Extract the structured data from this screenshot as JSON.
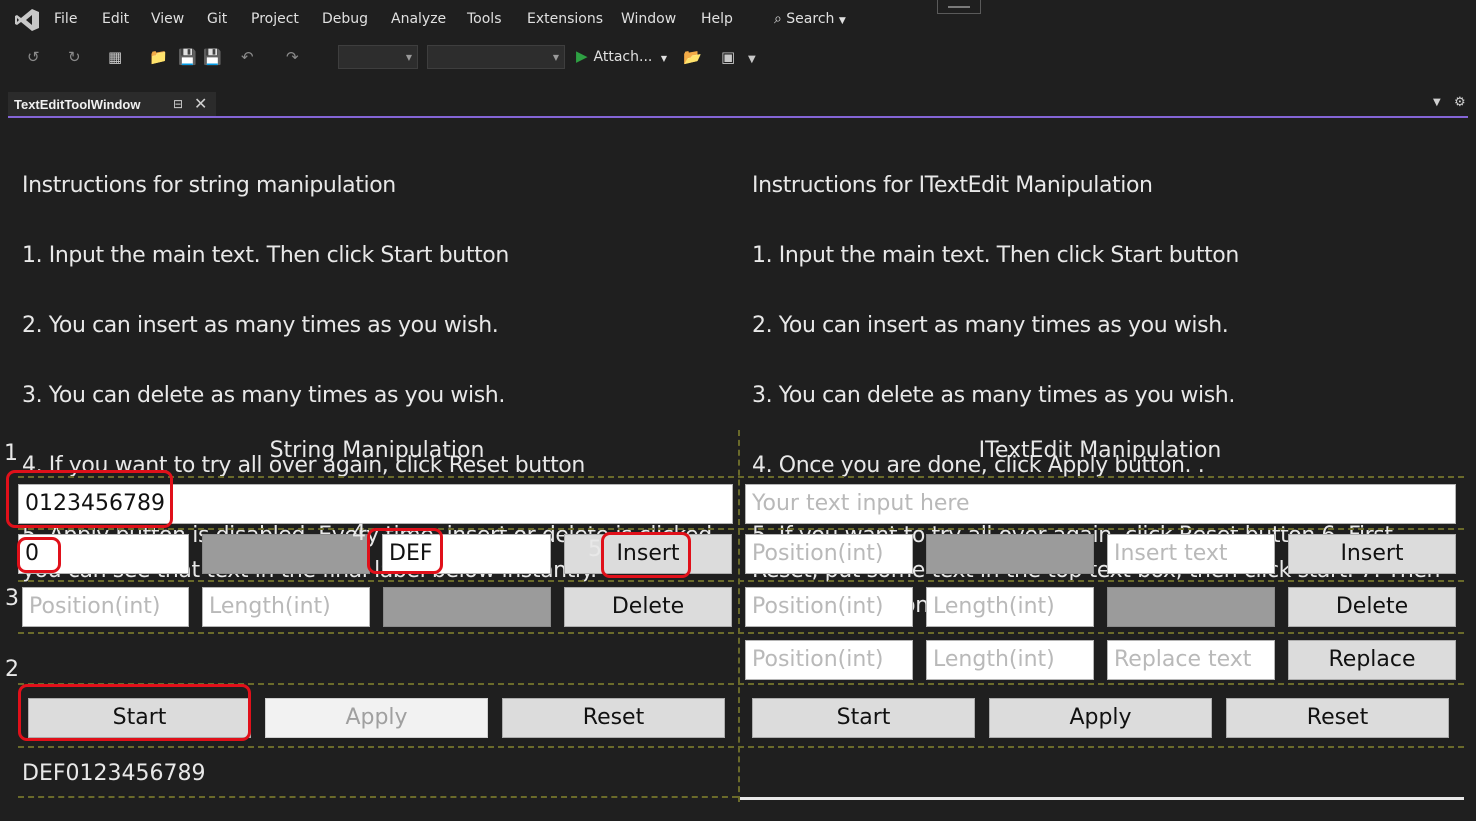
{
  "menu": {
    "items": [
      "File",
      "Edit",
      "View",
      "Git",
      "Project",
      "Debug",
      "Analyze",
      "Tools",
      "Extensions",
      "Window",
      "Help"
    ],
    "search_label": "Search"
  },
  "toolbar": {
    "attach_label": "Attach..."
  },
  "tab": {
    "title": "TextEditToolWindow"
  },
  "left": {
    "instructions": [
      "Instructions for string manipulation",
      "1. Input the main text. Then click Start button",
      "2. You can insert as many times as you wish.",
      "3. You can delete as many times as you wish.",
      "4. If you want to try all over again, click Reset button",
      "5. Apply button is disabled. Every time, insert or delete is clicked, you can see that text in the final label below instantly."
    ],
    "title": "String Manipulation",
    "main_text": "0123456789",
    "insert_position": "0",
    "insert_text": "DEF",
    "insert_label": "Insert",
    "delete_position_placeholder": "Position(int)",
    "delete_length_placeholder": "Length(int)",
    "delete_label": "Delete",
    "start_label": "Start",
    "apply_label": "Apply",
    "reset_label": "Reset",
    "result": "DEF0123456789"
  },
  "right": {
    "instructions": [
      "Instructions for ITextEdit Manipulation",
      "1. Input the main text. Then click Start button",
      "2. You can insert as many times as you wish.",
      "3. You can delete as many times as you wish.",
      "4. Once you are done, click Apply button. .",
      "5. If you want to try all over again, click Reset button 6. First, Reset, put some text in the top text box, then click start. 7. Then do the operation."
    ],
    "title": "ITextEdit Manipulation",
    "main_placeholder": "Your text input here",
    "insert_position_placeholder": "Position(int)",
    "insert_text_placeholder": "Insert text",
    "insert_label": "Insert",
    "delete_position_placeholder": "Position(int)",
    "delete_length_placeholder": "Length(int)",
    "delete_label": "Delete",
    "replace_position_placeholder": "Position(int)",
    "replace_length_placeholder": "Length(int)",
    "replace_text_placeholder": "Replace text",
    "replace_label": "Replace",
    "start_label": "Start",
    "apply_label": "Apply",
    "reset_label": "Reset"
  },
  "annotations": {
    "n1": "1",
    "n2": "2",
    "n3": "3",
    "n4": "4",
    "n5": "5"
  },
  "colors": {
    "accent_tab": "#8465d6",
    "annotation_red": "#e0101a",
    "background": "#1f1f1f"
  },
  "icons": [
    "vs-logo-icon",
    "search-icon",
    "back-icon",
    "forward-icon",
    "new-project-icon",
    "open-folder-icon",
    "save-icon",
    "save-all-icon",
    "undo-icon",
    "redo-icon",
    "play-icon",
    "pin-icon",
    "close-icon",
    "gear-icon"
  ]
}
